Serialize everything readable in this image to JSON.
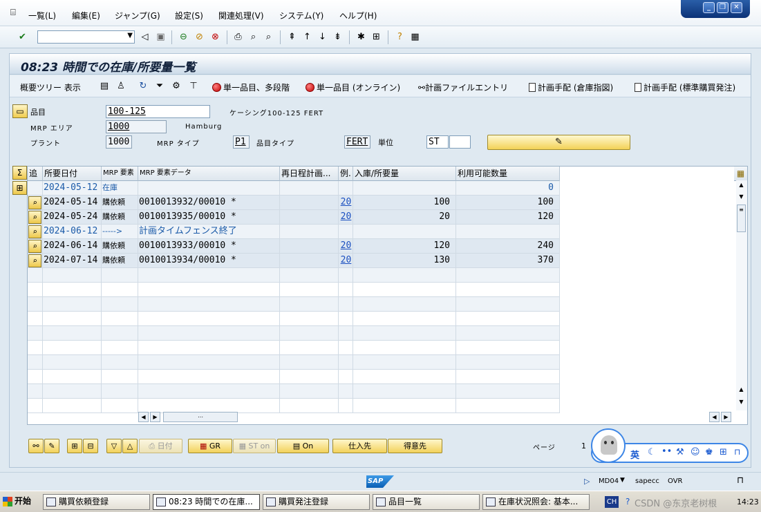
{
  "menu": [
    "一覧(L)",
    "編集(E)",
    "ジャンプ(G)",
    "設定(S)",
    "関連処理(V)",
    "システム(Y)",
    "ヘルプ(H)"
  ],
  "window_controls": {
    "minimize": "_",
    "restore": "❐",
    "close": "✕"
  },
  "toolbar": {
    "command_value": ""
  },
  "title": "08:23 時間での在庫/所要量一覧",
  "app_toolbar": {
    "overview_tree": "概要ツリー 表示",
    "single_multi": "単一品目、多段階",
    "single_online": "単一品目 (オンライン)",
    "planning_file": "計画ファイルエントリ",
    "plan_stock_transfer": "計画手配 (倉庫指図)",
    "plan_standard_po": "計画手配 (標準購買発注)"
  },
  "header": {
    "material_label": "品目",
    "material_value": "100-125",
    "material_desc": "ケーシング100-125 FERT",
    "mrp_area_label": "MRP エリア",
    "mrp_area_value": "1000",
    "mrp_area_desc": "Hamburg",
    "plant_label": "プラント",
    "plant_value": "1000",
    "mrp_type_label": "MRP タイプ",
    "mrp_type_value": "P1",
    "material_type_label": "品目タイプ",
    "material_type_value": "FERT",
    "unit_label": "単位",
    "unit_value": "ST",
    "unit_extra": ""
  },
  "grid": {
    "columns": [
      "追",
      "所要日付",
      "MRP 要素",
      "MRP 要素データ",
      "再日程計画...",
      "例.",
      "入庫/所要量",
      "利用可能数量"
    ],
    "rows": [
      {
        "date": "2024-05-12",
        "element": "在庫",
        "data": "",
        "resched": "",
        "exc": "",
        "qty": "",
        "avail": "0",
        "style": "blue",
        "zoom": false
      },
      {
        "date": "2024-05-14",
        "element": "購依頼",
        "data": "0010013932/00010 *",
        "resched": "",
        "exc": "20",
        "qty": "100",
        "avail": "100",
        "style": "data",
        "zoom": true
      },
      {
        "date": "2024-05-24",
        "element": "購依頼",
        "data": "0010013935/00010 *",
        "resched": "",
        "exc": "20",
        "qty": "20",
        "avail": "120",
        "style": "data",
        "zoom": true
      },
      {
        "date": "2024-06-12",
        "element": "----->",
        "data": "計画タイムフェンス終了",
        "resched": "",
        "exc": "",
        "qty": "",
        "avail": "",
        "style": "blue",
        "zoom": true
      },
      {
        "date": "2024-06-14",
        "element": "購依頼",
        "data": "0010013933/00010 *",
        "resched": "",
        "exc": "20",
        "qty": "120",
        "avail": "240",
        "style": "data",
        "zoom": true
      },
      {
        "date": "2024-07-14",
        "element": "購依頼",
        "data": "0010013934/00010 *",
        "resched": "",
        "exc": "20",
        "qty": "130",
        "avail": "370",
        "style": "data",
        "zoom": true
      }
    ]
  },
  "bottom_buttons": {
    "date": "日付",
    "gr": "GR",
    "st_on": "ST on",
    "on": "On",
    "vendor": "仕入先",
    "customer": "得意先",
    "page_label": "ページ",
    "page_value": "1"
  },
  "status": {
    "tcode": "MD04",
    "server": "sapecc",
    "mode": "OVR"
  },
  "ime": {
    "lang": "英"
  },
  "taskbar": {
    "start": "开始",
    "tasks": [
      "購買依頼登録",
      "08:23 時間での在庫...",
      "購買発注登録",
      "品目一覧",
      "在庫状況照会: 基本..."
    ],
    "lang": "CH",
    "watermark": "CSDN @东京老树根",
    "clock": "14:23"
  },
  "colors": {
    "accent": "#1a5aa8",
    "button": "#f2d15a",
    "panel": "#dfe9f1"
  }
}
